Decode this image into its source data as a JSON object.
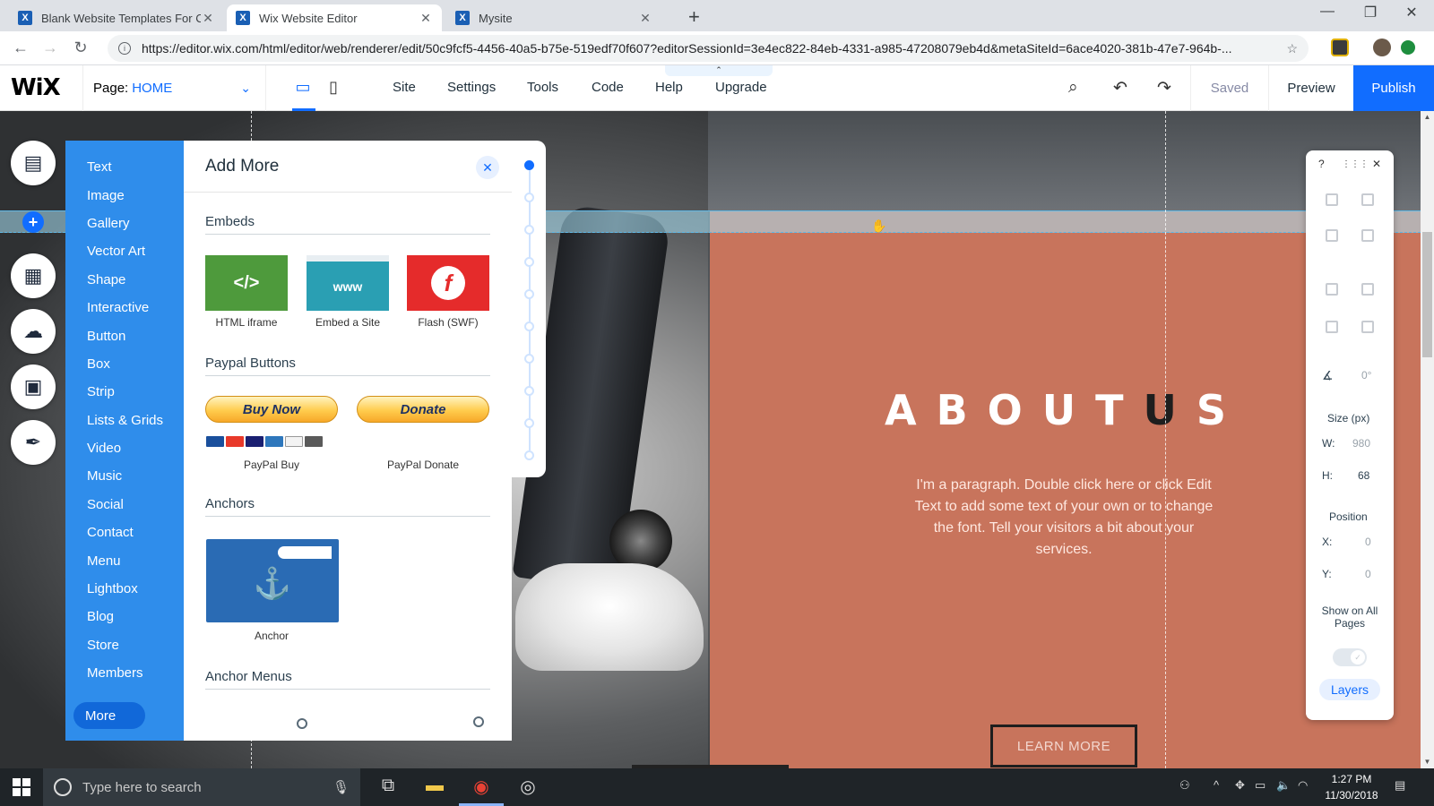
{
  "browser": {
    "tabs": [
      {
        "favicon": "X",
        "title": "Blank Website Templates For Cre",
        "close": "✕"
      },
      {
        "favicon": "X",
        "title": "Wix Website Editor",
        "close": "✕"
      },
      {
        "favicon": "X",
        "title": "Mysite",
        "close": "✕"
      }
    ],
    "new_tab": "+",
    "url": "https://editor.wix.com/html/editor/web/renderer/edit/50c9fcf5-4456-40a5-b75e-519edf70f607?editorSessionId=3e4ec822-84eb-4331-a985-47208079eb4d&metaSiteId=6ace4020-381b-47e7-964b-...",
    "window_controls": {
      "minimize": "—",
      "maximize": "❐",
      "close": "✕"
    },
    "nav": {
      "back": "←",
      "forward": "→",
      "reload": "↻",
      "star": "☆"
    }
  },
  "editor": {
    "logo": "WiX",
    "page_label": "Page:",
    "page_name": "HOME",
    "menu": [
      "Site",
      "Settings",
      "Tools",
      "Code",
      "Help",
      "Upgrade"
    ],
    "saved": "Saved",
    "preview": "Preview",
    "publish": "Publish",
    "collapse": "⌃"
  },
  "add_panel": {
    "title": "Add More",
    "categories": [
      "Text",
      "Image",
      "Gallery",
      "Vector Art",
      "Shape",
      "Interactive",
      "Button",
      "Box",
      "Strip",
      "Lists & Grids",
      "Video",
      "Music",
      "Social",
      "Contact",
      "Menu",
      "Lightbox",
      "Blog",
      "Store",
      "Members"
    ],
    "more": "More",
    "sections": {
      "embeds": "Embeds",
      "paypal": "Paypal Buttons",
      "anchors": "Anchors",
      "anchor_menus": "Anchor Menus"
    },
    "embeds": [
      {
        "label": "HTML iframe",
        "glyph": "</>",
        "color": "#4e9a3c"
      },
      {
        "label": "Embed a Site",
        "glyph": "www",
        "color": "#2a9fb3"
      },
      {
        "label": "Flash (SWF)",
        "glyph": "f",
        "color": "#e52b2b"
      }
    ],
    "paypal": [
      {
        "button": "Buy Now",
        "label": "PayPal Buy"
      },
      {
        "button": "Donate",
        "label": "PayPal Donate"
      }
    ],
    "anchor": {
      "label": "Anchor",
      "glyph": "⚓"
    }
  },
  "canvas": {
    "title": "ABOUTUS",
    "paragraph": "I'm a paragraph. Double click here or click Edit Text to add some text of your own or to change the font. Tell your visitors a bit about your services.",
    "button": "LEARN MORE",
    "accent": "#c8745c"
  },
  "inspector": {
    "help": "?",
    "drag": "⋮⋮⋮",
    "close": "✕",
    "rotation": "0°",
    "size_label": "Size (px)",
    "w_label": "W:",
    "w_value": "980",
    "h_label": "H:",
    "h_value": "68",
    "position_label": "Position",
    "x_label": "X:",
    "x_value": "0",
    "y_label": "Y:",
    "y_value": "0",
    "show_all": "Show on All Pages",
    "layers": "Layers"
  },
  "taskbar": {
    "search_placeholder": "Type here to search",
    "time": "1:27 PM",
    "date": "11/30/2018"
  }
}
